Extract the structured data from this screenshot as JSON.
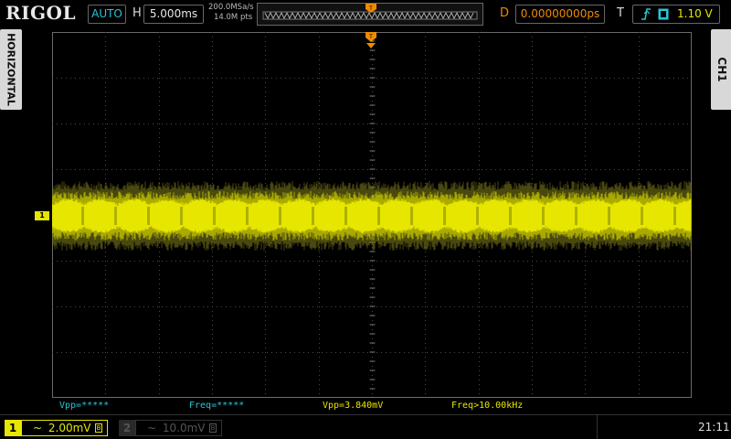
{
  "brand": "RIGOL",
  "top": {
    "trigger_mode": "AUTO",
    "h_label": "H",
    "timebase": "5.000ms",
    "sample_rate": "200.0MSa/s",
    "memory_depth": "14.0M pts",
    "d_label": "D",
    "delay": "0.00000000ps",
    "t_label": "T",
    "trigger_level": "1.10 V",
    "trigger_channel_icon": "1"
  },
  "side": {
    "left_tab": "HORIZONTAL",
    "right_tab": "CH1"
  },
  "markers": {
    "ch1_ground": "1"
  },
  "measurements": [
    {
      "text": "Vpp=*****",
      "color": "#2bc4d8"
    },
    {
      "text": "Freq=*****",
      "color": "#2bc4d8"
    },
    {
      "text": "Vpp=3.840mV",
      "color": "#e6e600"
    },
    {
      "text": "Freq>10.00kHz",
      "color": "#e6e600"
    }
  ],
  "bottom": {
    "ch1_number": "1",
    "ch1_scale": "2.00mV",
    "ch1_coupling_icon": "~",
    "ch1_badge": "B",
    "ch2_number": "2",
    "ch2_scale": "10.0mV",
    "ch2_coupling_icon": "~",
    "ch2_badge": "B",
    "clock": "21:11"
  },
  "colors": {
    "ch1": "#e6e600",
    "cyan": "#2bc4d8",
    "orange": "#f08a00",
    "grid": "#4a4a4a"
  },
  "icons": [
    "trigger-edge-rising-icon",
    "trigger-marker-icon",
    "coupling-ac-icon",
    "bandwidth-limit-icon"
  ]
}
